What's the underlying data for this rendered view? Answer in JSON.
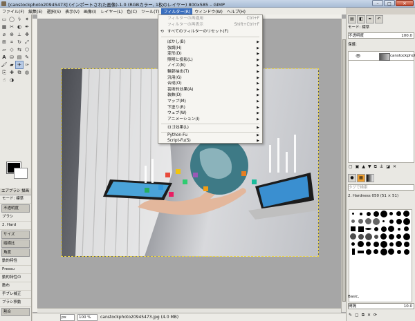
{
  "window": {
    "title": "[canstockphoto20945473] (インポートされた画像)-1.0 (RGBカラー, 1枚のレイヤー) 800x585 – GIMP",
    "min": "–",
    "max": "□",
    "close": "✕"
  },
  "menubar": [
    "ファイル(F)",
    "編集(E)",
    "選択(S)",
    "表示(V)",
    "画像(I)",
    "レイヤー(L)",
    "色(C)",
    "ツール(T)",
    "フィルター(R)",
    "ウィンドウ(W)",
    "ヘルプ(H)"
  ],
  "filters_menu": {
    "repeat": "フィルターの再適用",
    "repeat_shortcut": "Ctrl+F",
    "reshow": "フィルターの再表示",
    "reshow_shortcut": "Shift+Ctrl+F",
    "reset": "すべてのフィルターのリセット(F)",
    "submenus": [
      "ぼかし(B)",
      "強調(H)",
      "変形(D)",
      "照明と投影(L)",
      "ノイズ(N)",
      "輪郭抽出(T)",
      "汎用(G)",
      "合成(O)",
      "芸術的効果(A)",
      "装飾(D)",
      "マップ(M)",
      "下塗り(R)",
      "ウェブ(W)",
      "アニメーション(I)"
    ],
    "logo": "ロゴ効果(L)",
    "python": "Python-Fu",
    "script": "Script-Fu(S)"
  },
  "tool_options": {
    "title": "エアブラシ 描画",
    "mode_label": "モード: 標準",
    "opacity_label": "不透明度",
    "brush_label": "ブラシ",
    "brush_value": "2. Hard",
    "size_label": "サイズ",
    "ratio_label": "縦横比",
    "angle_label": "角度",
    "dynamics_label": "動的特性",
    "dynamics_value": "Pressu",
    "dynamics_options": "動的特性の",
    "jitter": "散布",
    "smoothing": "手ブレ補正",
    "motion": "ブラシ移動",
    "rate": "割合"
  },
  "layers_panel": {
    "mode": "モード: 標準",
    "opacity_label": "不透明度",
    "opacity_value": "100.0",
    "lock_label": "保護:",
    "layer_name": "canstockphoto"
  },
  "brushes_panel": {
    "filter_placeholder": "タグで検索",
    "current_brush": "2. Hardness 050 (51 × 51)",
    "tag_label": "Basic,",
    "spacing_label": "間隔",
    "spacing_value": "10.0"
  },
  "status": {
    "unit": "px",
    "zoom": "100 %",
    "file": "canstockphoto20945473.jpg (4.0 MB)"
  },
  "colors": {
    "accent": "#3a6fbf",
    "foreground": "#000000",
    "background": "#ffffff"
  }
}
